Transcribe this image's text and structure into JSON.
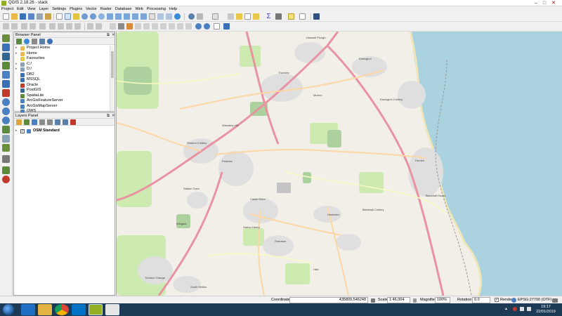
{
  "window": {
    "title": "QGIS 2.18.26 - stack"
  },
  "menu": [
    "Project",
    "Edit",
    "View",
    "Layer",
    "Settings",
    "Plugins",
    "Vector",
    "Raster",
    "Database",
    "Web",
    "Processing",
    "Help"
  ],
  "browser_panel": {
    "title": "Browser Panel",
    "items": [
      {
        "label": "Project Home",
        "icon": "folder-icon",
        "color": "#e8b84a"
      },
      {
        "label": "Home",
        "icon": "folder-icon",
        "color": "#e8b84a"
      },
      {
        "label": "Favourites",
        "icon": "star-icon",
        "color": "#e8c84a"
      },
      {
        "label": "C:/",
        "icon": "drive-icon",
        "color": "#8aa0b5"
      },
      {
        "label": "D:/",
        "icon": "drive-icon",
        "color": "#8aa0b5"
      },
      {
        "label": "DB2",
        "icon": "database-icon",
        "color": "#3b6fb6"
      },
      {
        "label": "MSSQL",
        "icon": "database-icon",
        "color": "#3b6fb6"
      },
      {
        "label": "Oracle",
        "icon": "database-icon",
        "color": "#c0392b"
      },
      {
        "label": "PostGIS",
        "icon": "elephant-icon",
        "color": "#336791"
      },
      {
        "label": "SpatiaLite",
        "icon": "feather-icon",
        "color": "#5c8a3c"
      },
      {
        "label": "ArcGisFeatureServer",
        "icon": "globe-icon",
        "color": "#4a7fc1"
      },
      {
        "label": "ArcGisMapServer",
        "icon": "globe-icon",
        "color": "#4a7fc1"
      },
      {
        "label": "OWS",
        "icon": "globe-icon",
        "color": "#4a7fc1"
      }
    ]
  },
  "layers_panel": {
    "title": "Layers Panel",
    "layers": [
      {
        "label": "OSM Standard",
        "checked": true
      }
    ]
  },
  "map": {
    "labels": [
      "Haswell Plough",
      "Easington",
      "Easington Colliery",
      "Horden",
      "Peterlee",
      "Shotton Colliery",
      "Castle Eden",
      "Wingate",
      "Hutton Henry",
      "Hesleden",
      "Blackhall Colliery",
      "Hart",
      "Sheraton",
      "Station Town",
      "Wheatley Hill",
      "Trimdon Grange",
      "Blackhall Rocks",
      "Thornley",
      "Murton",
      "South Hetton"
    ]
  },
  "statusbar": {
    "coordinate_label": "Coordinate",
    "coordinate_value": "435809,546248",
    "scale_label": "Scale",
    "scale_value": "1:46,004",
    "magnifier_label": "Magnifier",
    "magnifier_value": "100%",
    "rotation_label": "Rotation",
    "rotation_value": "0.0",
    "render_label": "Render",
    "crs": "EPSG:27700 (OTF)"
  },
  "taskbar": {
    "time": "19:17",
    "date": "22/01/2019"
  }
}
